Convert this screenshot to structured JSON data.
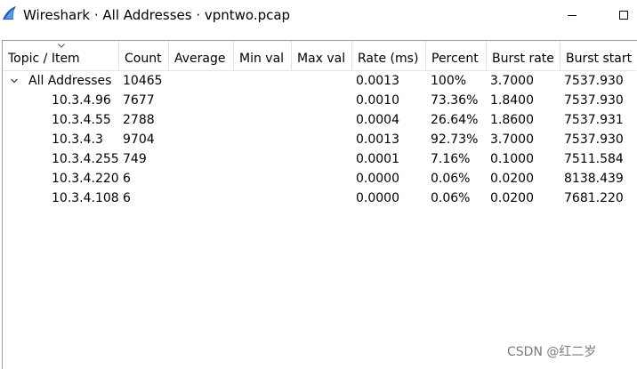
{
  "window": {
    "title": "Wireshark · All Addresses · vpntwo.pcap"
  },
  "table": {
    "columns": [
      {
        "label": "Topic / Item"
      },
      {
        "label": "Count"
      },
      {
        "label": "Average"
      },
      {
        "label": "Min val"
      },
      {
        "label": "Max val"
      },
      {
        "label": "Rate (ms)"
      },
      {
        "label": "Percent"
      },
      {
        "label": "Burst rate"
      },
      {
        "label": "Burst start"
      }
    ],
    "rows": [
      {
        "item": "All Addresses",
        "count": "10465",
        "average": "",
        "min": "",
        "max": "",
        "rate": "0.0013",
        "percent": "100%",
        "burst_rate": "3.7000",
        "burst_start": "7537.930"
      },
      {
        "item": "10.3.4.96",
        "count": "7677",
        "average": "",
        "min": "",
        "max": "",
        "rate": "0.0010",
        "percent": "73.36%",
        "burst_rate": "1.8400",
        "burst_start": "7537.930"
      },
      {
        "item": "10.3.4.55",
        "count": "2788",
        "average": "",
        "min": "",
        "max": "",
        "rate": "0.0004",
        "percent": "26.64%",
        "burst_rate": "1.8600",
        "burst_start": "7537.931"
      },
      {
        "item": "10.3.4.3",
        "count": "9704",
        "average": "",
        "min": "",
        "max": "",
        "rate": "0.0013",
        "percent": "92.73%",
        "burst_rate": "3.7000",
        "burst_start": "7537.930"
      },
      {
        "item": "10.3.4.255",
        "count": "749",
        "average": "",
        "min": "",
        "max": "",
        "rate": "0.0001",
        "percent": "7.16%",
        "burst_rate": "0.1000",
        "burst_start": "7511.584"
      },
      {
        "item": "10.3.4.220",
        "count": "6",
        "average": "",
        "min": "",
        "max": "",
        "rate": "0.0000",
        "percent": "0.06%",
        "burst_rate": "0.0200",
        "burst_start": "8138.439"
      },
      {
        "item": "10.3.4.108",
        "count": "6",
        "average": "",
        "min": "",
        "max": "",
        "rate": "0.0000",
        "percent": "0.06%",
        "burst_rate": "0.0200",
        "burst_start": "7681.220"
      }
    ]
  },
  "watermark": "CSDN @红二岁",
  "icons": {
    "app": "wireshark-fin-icon",
    "expander": "chevron-down-icon",
    "sort": "sort-ascending-icon"
  },
  "colors": {
    "icon_blue": "#1f5fbf"
  }
}
